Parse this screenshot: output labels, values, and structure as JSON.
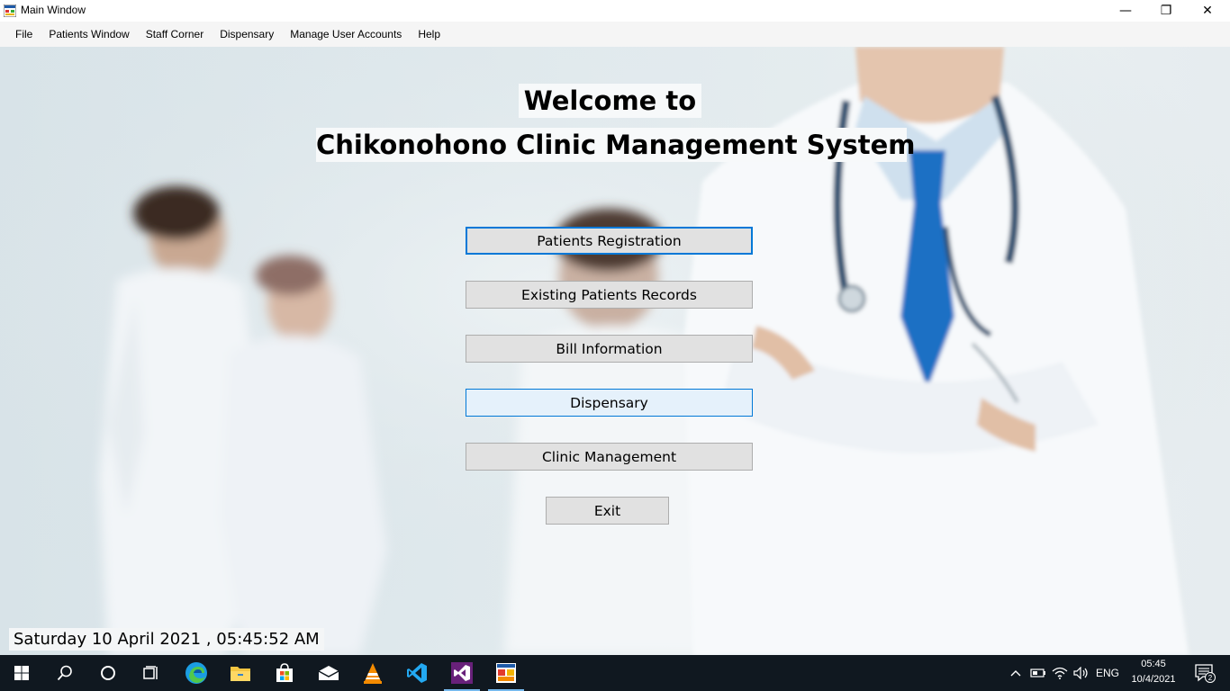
{
  "window": {
    "title": "Main Window",
    "minimize_glyph": "—",
    "maximize_glyph": "❐",
    "close_glyph": "✕"
  },
  "menu": {
    "items": [
      "File",
      "Patients Window",
      "Staff Corner",
      "Dispensary",
      "Manage User Accounts",
      "Help"
    ]
  },
  "main": {
    "welcome_line1": "Welcome to",
    "welcome_line2": "Chikonohono Clinic Management System",
    "buttons": {
      "patients_registration": "Patients Registration",
      "existing_patients_records": "Existing Patients Records",
      "bill_information": "Bill Information",
      "dispensary": "Dispensary",
      "clinic_management": "Clinic Management",
      "exit": "Exit"
    },
    "datetime": "Saturday 10 April 2021 , 05:45:52 AM"
  },
  "taskbar": {
    "pinned_icons": [
      "windows-start-icon",
      "search-icon",
      "cortana-icon",
      "task-view-icon",
      "edge-icon",
      "file-explorer-icon",
      "store-icon",
      "mail-icon",
      "vlc-icon",
      "vscode-icon",
      "visual-studio-icon",
      "app-icon"
    ],
    "tray": {
      "language": "ENG",
      "time": "05:45",
      "date": "10/4/2021",
      "notification_count": "2"
    }
  },
  "colors": {
    "accent": "#0078d7",
    "taskbar": "#101820",
    "button_face": "#e1e1e1",
    "doctor_tie": "#1a6fc4"
  }
}
